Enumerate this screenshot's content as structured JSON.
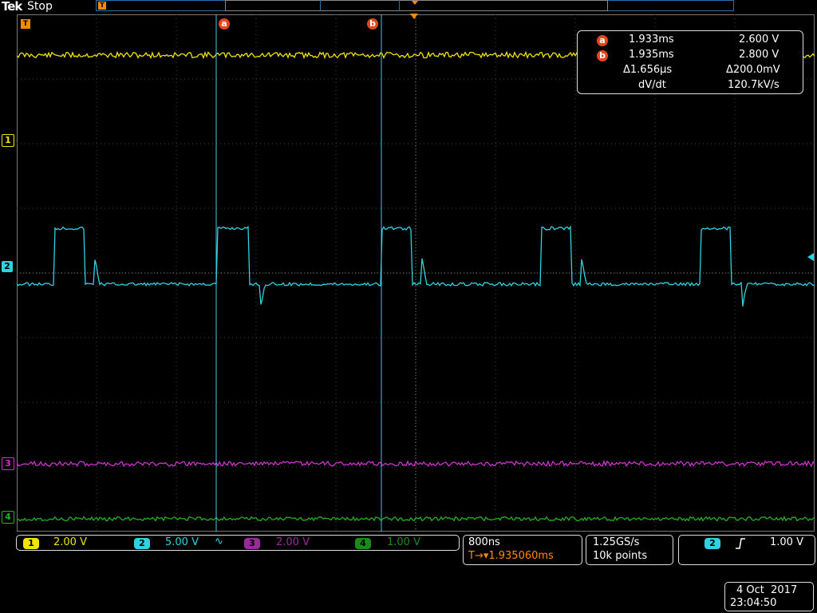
{
  "header": {
    "brand": "Tek",
    "run_state": "Stop",
    "trigger_marker": "T",
    "cursor_a_label": "a",
    "cursor_b_label": "b"
  },
  "channels": [
    {
      "id": "1",
      "color": "#f2e300",
      "scale": "2.00 V"
    },
    {
      "id": "2",
      "color": "#2fd3e0",
      "scale": "5.00 V",
      "coupling_icon": "∿"
    },
    {
      "id": "3",
      "color": "#cc33cc",
      "scale": "2.00 V"
    },
    {
      "id": "4",
      "color": "#22b022",
      "scale": "1.00 V"
    }
  ],
  "cursor_readout": {
    "a_time": "1.933ms",
    "a_value": "2.600 V",
    "b_time": "1.935ms",
    "b_value": "2.800 V",
    "delta_time": "Δ1.656µs",
    "delta_value": "Δ200.0mV",
    "rate_label": "dV/dt",
    "rate_value": "120.7kV/s"
  },
  "horizontal": {
    "timebase": "800ns",
    "trigger_position": "T→▾1.935060ms",
    "sample_rate": "1.25GS/s",
    "record_length": "10k points"
  },
  "trigger": {
    "source": "2",
    "slope_icon": "rising-edge-icon",
    "level": "1.00 V"
  },
  "datetime": {
    "date": "4 Oct  2017",
    "time": "23:04:50"
  },
  "colors": {
    "grid": "#444444",
    "cursor": "#49c8e0",
    "accent": "#ff8a00"
  }
}
